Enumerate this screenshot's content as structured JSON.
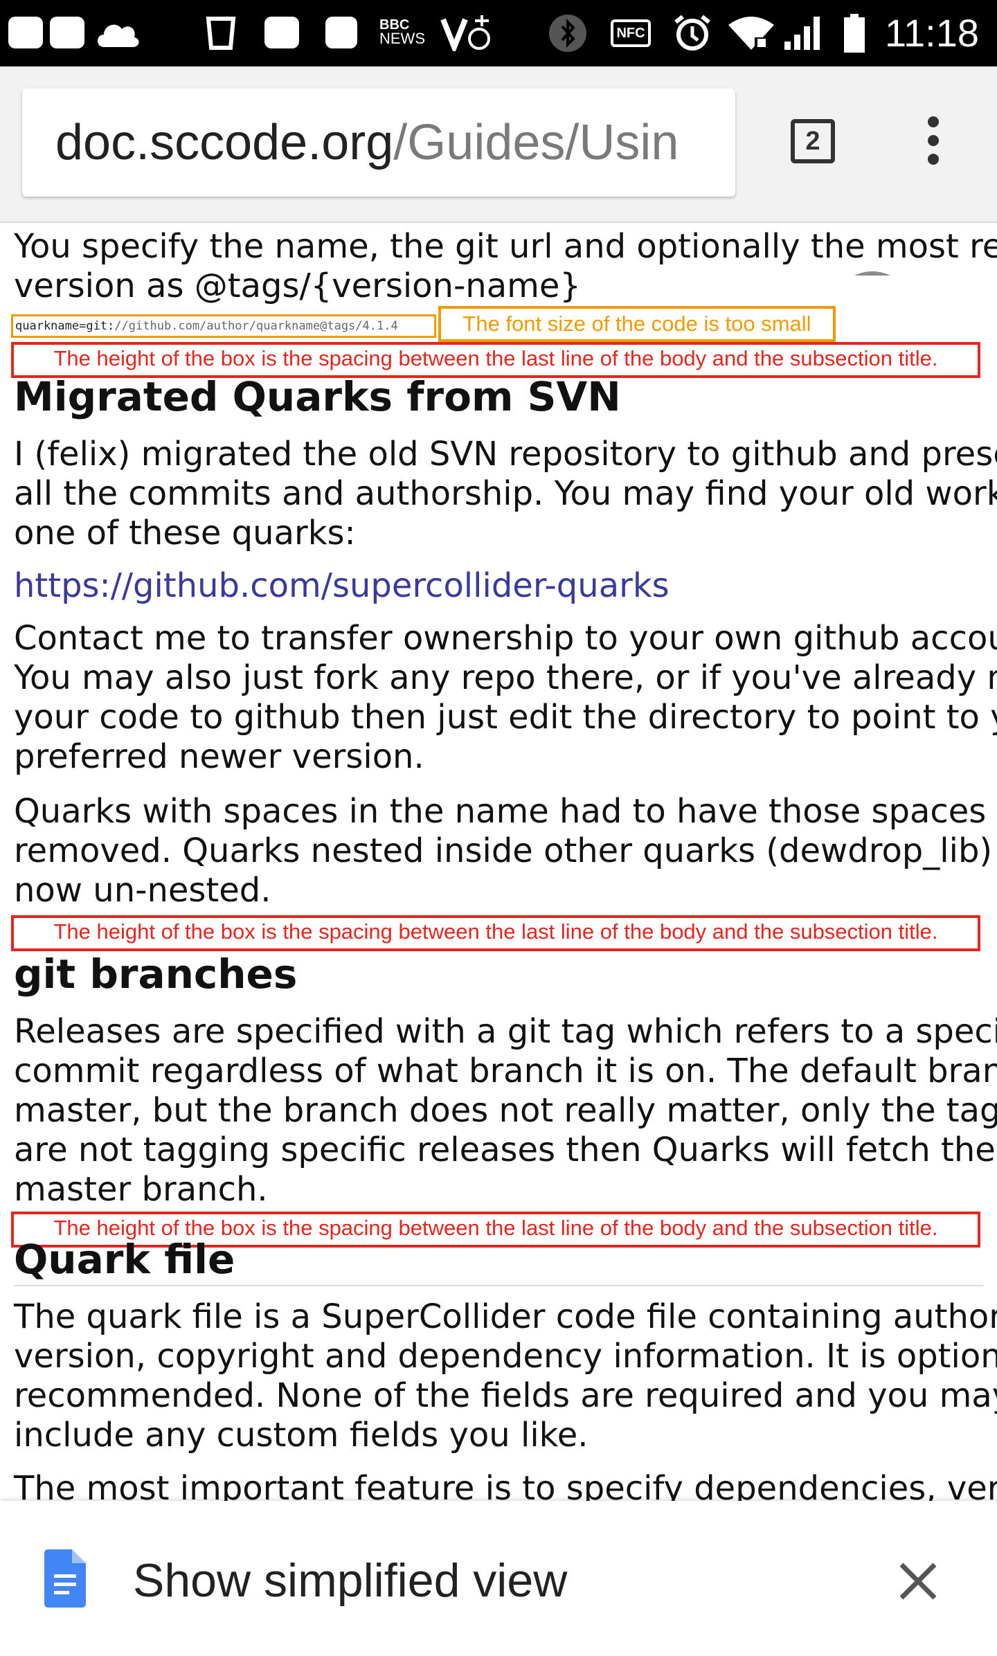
{
  "status_bar": {
    "bbc_top": "BBC",
    "bbc_bottom": "NEWS",
    "nfc_label": "NFC",
    "clock": "11:18"
  },
  "toolbar": {
    "url_host": "doc.sccode.org",
    "url_path": "/Guides/Usin",
    "tab_count": "2"
  },
  "content": {
    "intro_lines": [
      "You specify the name, the git url and optionally the most recent",
      "version as @tags/{version-name}"
    ],
    "code_prefix": "quarkname=git:",
    "code_path": "//github.com/author/quarkname@tags/4.1.4",
    "annotation_font": "The font size of the code is too small",
    "annotation_spacing": "The height of the box is the spacing between the last line of the body and the subsection title.",
    "heading_migrated": "Migrated Quarks from SVN",
    "migrated_p1": [
      "I (felix) migrated the old SVN repository to github and preserved",
      "all the commits and authorship. You may find your old work in",
      "one of these quarks:"
    ],
    "migrated_link": "https://github.com/supercollider-quarks",
    "migrated_p2": [
      "Contact me to transfer ownership to your own github account.",
      "You may also just fork any repo there, or if you've already moved",
      "your code to github then just edit the directory to point to your",
      "preferred newer version."
    ],
    "migrated_p3": [
      "Quarks with spaces in the name had to have those spaces",
      "removed. Quarks nested inside other quarks (dewdrop_lib) are",
      "now un-nested."
    ],
    "heading_branches": "git branches",
    "branches_p1": [
      "Releases are specified with a git tag which refers to a specific",
      "commit regardless of what branch it is on. The default branch is",
      "master, but the branch does not really matter, only the tag. If you",
      "are not tagging specific releases then Quarks will fetch the",
      "master branch."
    ],
    "heading_quarkfile": "Quark file",
    "quarkfile_p1": [
      "The quark file is a SuperCollider code file containing authorship,",
      "version, copyright and dependency information. It is optional but",
      "recommended. None of the fields are required and you may",
      "include any custom fields you like."
    ],
    "quarkfile_p2": "The most important feature is to specify dependencies, version,"
  },
  "bottom_bar": {
    "label": "Show simplified view"
  },
  "colors": {
    "annotation_red": "#e5261f",
    "annotation_orange": "#f29a00",
    "link": "#3a3a9a"
  }
}
